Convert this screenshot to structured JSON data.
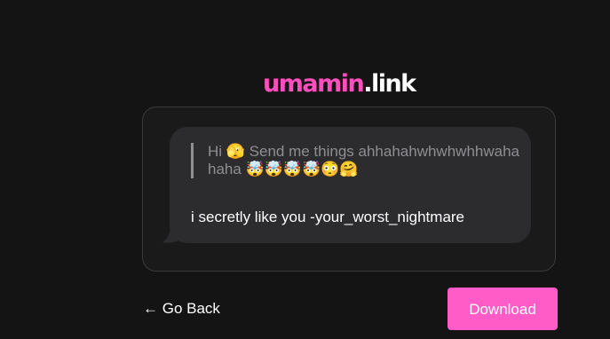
{
  "logo": {
    "brand": "umamin",
    "tld": ".link"
  },
  "message": {
    "prompt": "Hi 🫣 Send me things ahhahahwhwhwhhwahahaha 🤯🤯🤯🤯😳🤗",
    "reply": "i secretly like you -your_worst_nightmare"
  },
  "actions": {
    "back_label": "← Go Back",
    "download_label": "Download"
  },
  "colors": {
    "accent": "#ff5cc8",
    "brand": "#ff4fbf",
    "background": "#141414",
    "card": "#1a1a1b",
    "bubble": "#2c2c2e",
    "muted_text": "#8e8e93"
  }
}
